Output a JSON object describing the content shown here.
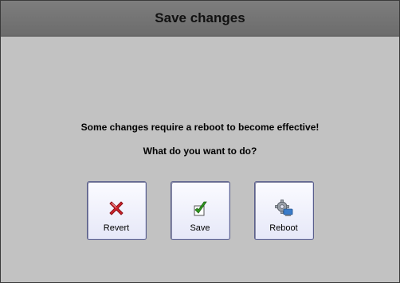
{
  "dialog": {
    "title": "Save changes",
    "message_line1": "Some changes require a reboot to become effective!",
    "message_line2": "What do you want to do?"
  },
  "buttons": [
    {
      "label": "Revert",
      "icon": "red-x-icon"
    },
    {
      "label": "Save",
      "icon": "checkmark-icon"
    },
    {
      "label": "Reboot",
      "icon": "gear-computer-icon"
    }
  ],
  "colors": {
    "titlebar": "#737373",
    "background": "#c2c2c2",
    "button_border": "#5a5f8c",
    "revert_icon": "#d0232b",
    "save_check": "#2f9a1e"
  }
}
